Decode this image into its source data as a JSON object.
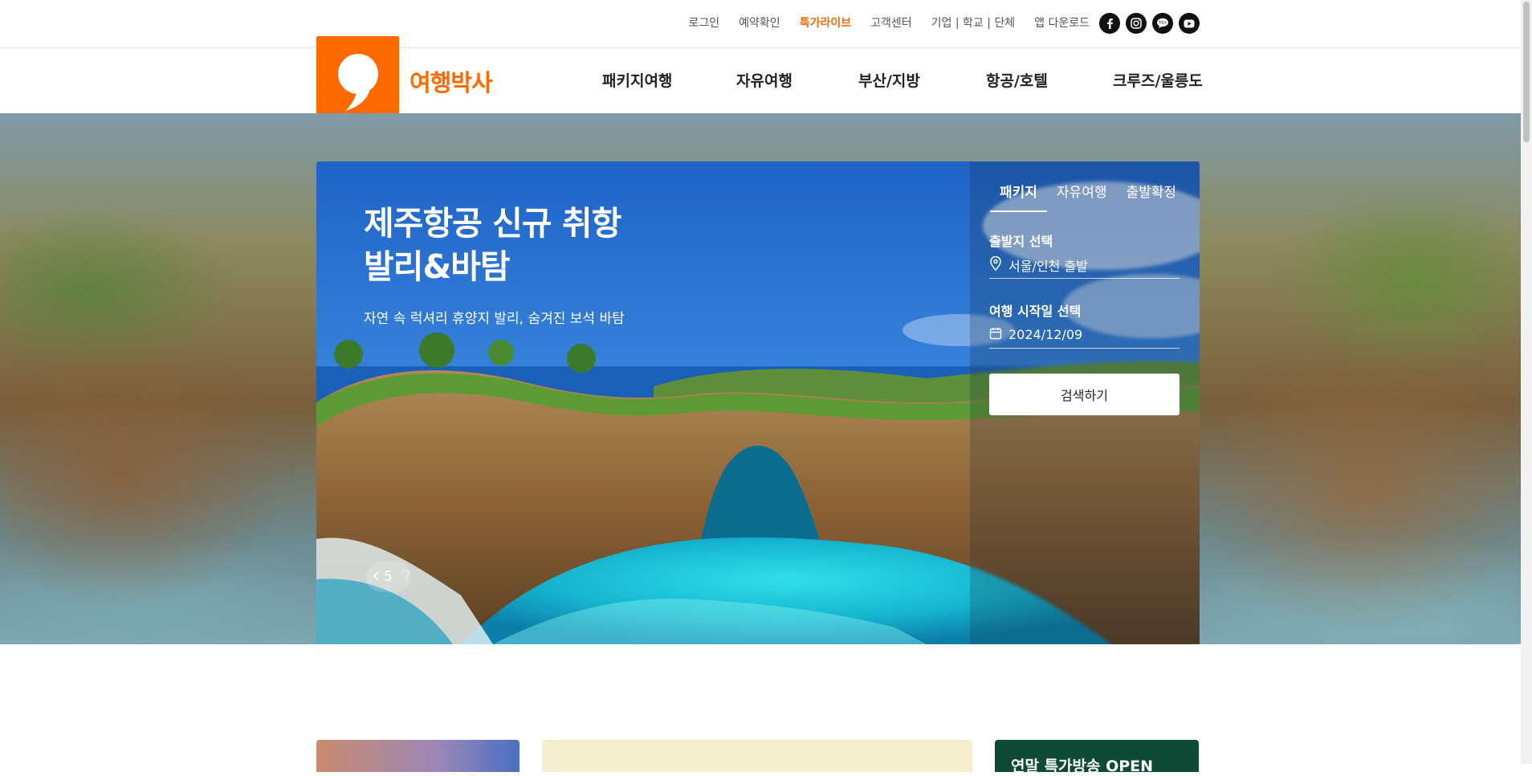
{
  "utility_nav": {
    "login": "로그인",
    "reservation": "예약확인",
    "live_deal": "특가라이브",
    "support": "고객센터",
    "corporate": "기업 | 학교 | 단체",
    "app_download": "앱 다운로드"
  },
  "social": [
    "facebook-icon",
    "instagram-icon",
    "talk-icon",
    "youtube-icon"
  ],
  "brand": {
    "name": "여행박사",
    "color": "#ff6a00"
  },
  "main_nav": [
    "패키지여행",
    "자유여행",
    "부산/지방",
    "항공/호텔",
    "크루즈/울릉도"
  ],
  "hero": {
    "title_line1": "제주항공 신규 취항",
    "title_line2": "발리&바탐",
    "subtitle": "자연 속 럭셔리 휴양지 발리, 숨겨진 보석 바탐",
    "current_slide": "5",
    "total_slides": "7"
  },
  "search_panel": {
    "tabs": [
      "패키지",
      "자유여행",
      "출발확정"
    ],
    "departure_label": "출발지 선택",
    "departure_value": "서울/인천 출발",
    "date_label": "여행 시작일 선택",
    "date_value": "2024/12/09",
    "search_button": "검색하기"
  },
  "promo_cards": {
    "card3_title": "연말 특가방송 OPEN"
  }
}
